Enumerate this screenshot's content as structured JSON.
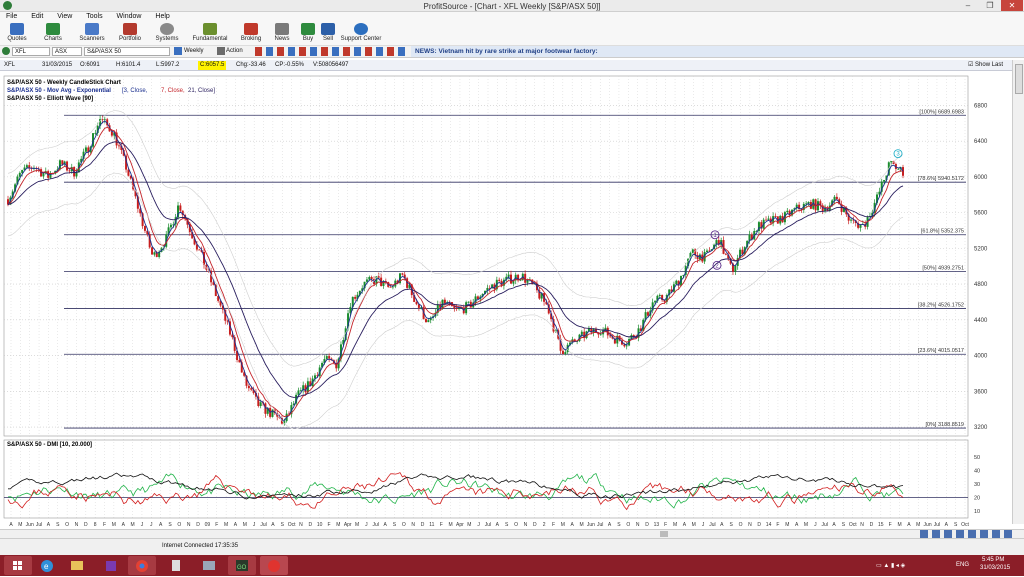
{
  "window": {
    "title": "ProfitSource - [Chart - XFL Weekly [S&P/ASX 50]]",
    "minimize": "–",
    "maximize": "❐",
    "close": "✕"
  },
  "menu": [
    "File",
    "Edit",
    "View",
    "Tools",
    "Window",
    "Help"
  ],
  "toolbar": [
    "Quotes",
    "Charts",
    "Scanners",
    "Portfolio",
    "Systems",
    "Fundamental",
    "Broking",
    "News",
    "Buy",
    "Sell",
    "Support Center"
  ],
  "symbol_bar": {
    "symbol": "XFL",
    "exchange": "ASX",
    "name": "S&P/ASX 50",
    "period": "Weekly",
    "action": "Action",
    "news": "NEWS: Vietnam hit by rare strike at major footwear factory:"
  },
  "quote": {
    "symbol": "XFL",
    "date": "31/03/2015",
    "open": "O:6091",
    "high": "H:6101.4",
    "low": "L:5997.2",
    "close": "C:6057.5",
    "change": "Chg:-33.46",
    "change_pct": "CP:-0.55%",
    "volume": "V:508056497",
    "show_last": "Show Last"
  },
  "chart_titles": {
    "main": "S&P/ASX 50 - Weekly CandleStick Chart",
    "mov_avg": "S&P/ASX 50 - Mov Avg - Exponential",
    "mov_avg_params": [
      "[3, Close,",
      "7, Close,",
      "21, Close]"
    ],
    "elliott": "S&P/ASX 50 - Elliott Wave [90]",
    "dmi": "S&P/ASX 50 - DMI [10, 20.000]"
  },
  "colors": {
    "mov3": "#1a2f8f",
    "mov7": "#c4242a",
    "mov21": "#2a1f5f",
    "candle_up": "#1a8c2e",
    "candle_down": "#c81e1e",
    "dmi_plus": "#22b44a",
    "dmi_minus": "#d21e1e",
    "adx": "#111111",
    "fib": "#303060",
    "taskbar": "#8b1e28"
  },
  "chart_data": {
    "type": "candlestick",
    "title": "S&P/ASX 50 - Weekly CandleStick Chart",
    "ylim": [
      3100,
      6950
    ],
    "y_ticks": [
      3200,
      3600,
      4000,
      4400,
      4800,
      5200,
      5600,
      6000,
      6400,
      6800
    ],
    "x_tick_labels": [
      "A",
      "M",
      "Jun",
      "Jul",
      "A",
      "S",
      "O",
      "N",
      "D",
      "8",
      "F",
      "M",
      "A",
      "M",
      "J",
      "J",
      "A",
      "S",
      "O",
      "N",
      "D",
      "09",
      "F",
      "M",
      "A",
      "M",
      "J",
      "Jul",
      "A",
      "S",
      "Oct",
      "N",
      "D",
      "10",
      "F",
      "M",
      "Apr",
      "M",
      "J",
      "Jul",
      "A",
      "S",
      "O",
      "N",
      "D",
      "11",
      "F",
      "M",
      "Apr",
      "M",
      "J",
      "Jul",
      "A",
      "S",
      "O",
      "N",
      "D",
      "2",
      "F",
      "M",
      "A",
      "M",
      "Jun",
      "Jul",
      "A",
      "S",
      "O",
      "N",
      "D",
      "13",
      "F",
      "M",
      "A",
      "M",
      "J",
      "Jul",
      "A",
      "S",
      "O",
      "N",
      "D",
      "14",
      "F",
      "M",
      "A",
      "M",
      "J",
      "Jul",
      "A",
      "S",
      "Oct",
      "N",
      "D",
      "15",
      "F",
      "M",
      "A",
      "M",
      "Jun",
      "Jul",
      "A",
      "S",
      "Oct"
    ],
    "fibonacci": [
      {
        "label": "[100%] 6689.6983",
        "value": 6689.6983
      },
      {
        "label": "[78.6%] 5940.5172",
        "value": 5940.5172
      },
      {
        "label": "[61.8%] 5352.375",
        "value": 5352.375
      },
      {
        "label": "[50%] 4939.2751",
        "value": 4939.2751
      },
      {
        "label": "[38.2%] 4526.1752",
        "value": 4526.1752
      },
      {
        "label": "[23.6%] 4015.0517",
        "value": 4015.0517
      },
      {
        "label": "[0%] 3188.8519",
        "value": 3188.8519
      }
    ],
    "series_close": [
      5750,
      6050,
      6120,
      6000,
      6150,
      6050,
      6300,
      6650,
      6500,
      6100,
      5600,
      5100,
      5300,
      5700,
      5350,
      5000,
      4600,
      4200,
      3700,
      3450,
      3350,
      3250,
      3550,
      3700,
      3950,
      3900,
      4600,
      4800,
      4850,
      4750,
      4900,
      4600,
      4350,
      4600,
      4500,
      4550,
      4700,
      4800,
      4850,
      4900,
      4750,
      4550,
      4050,
      4150,
      4250,
      4300,
      4200,
      4150,
      4300,
      4600,
      4650,
      4850,
      5150,
      5100,
      5300,
      4950,
      5250,
      5450,
      5500,
      5550,
      5650,
      5700,
      5650,
      5750,
      5500,
      5450,
      5750,
      6150,
      6057.5
    ],
    "elliott_labels": [
      "1",
      "2",
      "3"
    ],
    "dmi": {
      "title": "S&P/ASX 50 - DMI [10, 20.000]",
      "ylim": [
        5,
        55
      ],
      "y_ticks": [
        10,
        20,
        30,
        40,
        50
      ]
    }
  },
  "status": {
    "connection": "Internet Connected 17:35:35"
  },
  "taskbar": {
    "lang": "ENG",
    "time": "5:45 PM",
    "date": "31/03/2015"
  }
}
